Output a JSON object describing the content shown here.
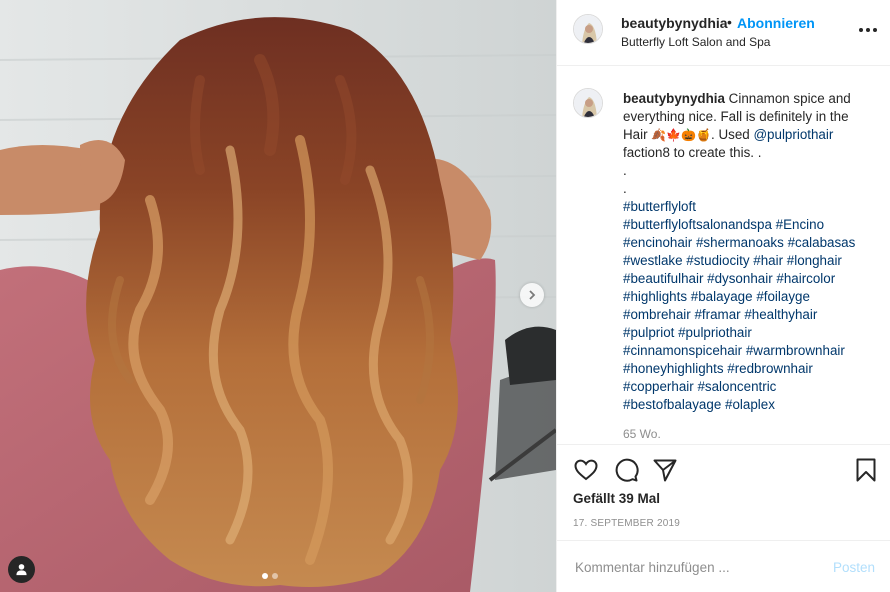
{
  "post": {
    "username": "beautybynydhia",
    "follow_label": "Abonnieren",
    "separator": "•",
    "location": "Butterfly Loft Salon and Spa",
    "caption_lines": [
      {
        "parts": [
          {
            "t": "beautybynydhia",
            "k": "user"
          },
          {
            "t": " Cinnamon spice and",
            "k": "text"
          }
        ]
      },
      {
        "parts": [
          {
            "t": "everything nice. Fall is definitely in the",
            "k": "text"
          }
        ]
      },
      {
        "parts": [
          {
            "t": "Hair ",
            "k": "text"
          },
          {
            "t": "🍂🍁🎃🍯",
            "k": "emoji"
          },
          {
            "t": ". Used ",
            "k": "text"
          },
          {
            "t": "@pulpriothair",
            "k": "link"
          }
        ]
      },
      {
        "parts": [
          {
            "t": "faction8 to create this. .",
            "k": "text"
          }
        ]
      },
      {
        "parts": [
          {
            "t": ".",
            "k": "text"
          }
        ]
      },
      {
        "parts": [
          {
            "t": ".",
            "k": "text"
          }
        ]
      },
      {
        "parts": [
          {
            "t": "#butterflyloft",
            "k": "link"
          }
        ]
      },
      {
        "parts": [
          {
            "t": "#butterflyloftsalonandspa",
            "k": "link"
          },
          {
            "t": " ",
            "k": "text"
          },
          {
            "t": "#Encino",
            "k": "link"
          }
        ]
      },
      {
        "parts": [
          {
            "t": "#encinohair",
            "k": "link"
          },
          {
            "t": " ",
            "k": "text"
          },
          {
            "t": "#shermanoaks",
            "k": "link"
          },
          {
            "t": " ",
            "k": "text"
          },
          {
            "t": "#calabasas",
            "k": "link"
          }
        ]
      },
      {
        "parts": [
          {
            "t": "#westlake",
            "k": "link"
          },
          {
            "t": " ",
            "k": "text"
          },
          {
            "t": "#studiocity",
            "k": "link"
          },
          {
            "t": " ",
            "k": "text"
          },
          {
            "t": "#hair",
            "k": "link"
          },
          {
            "t": " ",
            "k": "text"
          },
          {
            "t": "#longhair",
            "k": "link"
          }
        ]
      },
      {
        "parts": [
          {
            "t": "#beautifulhair",
            "k": "link"
          },
          {
            "t": " ",
            "k": "text"
          },
          {
            "t": "#dysonhair",
            "k": "link"
          },
          {
            "t": " ",
            "k": "text"
          },
          {
            "t": "#haircolor",
            "k": "link"
          }
        ]
      },
      {
        "parts": [
          {
            "t": "#highlights",
            "k": "link"
          },
          {
            "t": " ",
            "k": "text"
          },
          {
            "t": "#balayage",
            "k": "link"
          },
          {
            "t": " ",
            "k": "text"
          },
          {
            "t": "#foilayge",
            "k": "link"
          }
        ]
      },
      {
        "parts": [
          {
            "t": "#ombrehair",
            "k": "link"
          },
          {
            "t": " ",
            "k": "text"
          },
          {
            "t": "#framar",
            "k": "link"
          },
          {
            "t": " ",
            "k": "text"
          },
          {
            "t": "#healthyhair",
            "k": "link"
          }
        ]
      },
      {
        "parts": [
          {
            "t": "#pulpriot",
            "k": "link"
          },
          {
            "t": " ",
            "k": "text"
          },
          {
            "t": "#pulpriothair",
            "k": "link"
          }
        ]
      },
      {
        "parts": [
          {
            "t": "#cinnamonspicehair",
            "k": "link"
          },
          {
            "t": " ",
            "k": "text"
          },
          {
            "t": "#warmbrownhair",
            "k": "link"
          }
        ]
      },
      {
        "parts": [
          {
            "t": "#honeyhighlights",
            "k": "link"
          },
          {
            "t": " ",
            "k": "text"
          },
          {
            "t": "#redbrownhair",
            "k": "link"
          }
        ]
      },
      {
        "parts": [
          {
            "t": "#copperhair",
            "k": "link"
          },
          {
            "t": " ",
            "k": "text"
          },
          {
            "t": "#saloncentric",
            "k": "link"
          }
        ]
      },
      {
        "parts": [
          {
            "t": "#bestofbalayage",
            "k": "link"
          },
          {
            "t": " ",
            "k": "text"
          },
          {
            "t": "#olaplex",
            "k": "link"
          }
        ]
      }
    ],
    "time_ago": "65 Wo.",
    "likes_text": "Gefällt 39 Mal",
    "date_text": "17. SEPTEMBER 2019",
    "comment_placeholder": "Kommentar hinzufügen ...",
    "post_label": "Posten"
  },
  "carousel": {
    "slide_count": 2,
    "active_index": 0
  },
  "icons": {
    "more": "more-options-icon",
    "like": "heart-icon",
    "comment": "comment-icon",
    "share": "paper-plane-icon",
    "save": "bookmark-icon",
    "next": "chevron-right-icon",
    "tags": "user-tag-icon"
  },
  "colors": {
    "accent": "#0095f6",
    "link": "#00376b",
    "muted": "#8e8e8e",
    "post_disabled": "#b2dffc"
  }
}
